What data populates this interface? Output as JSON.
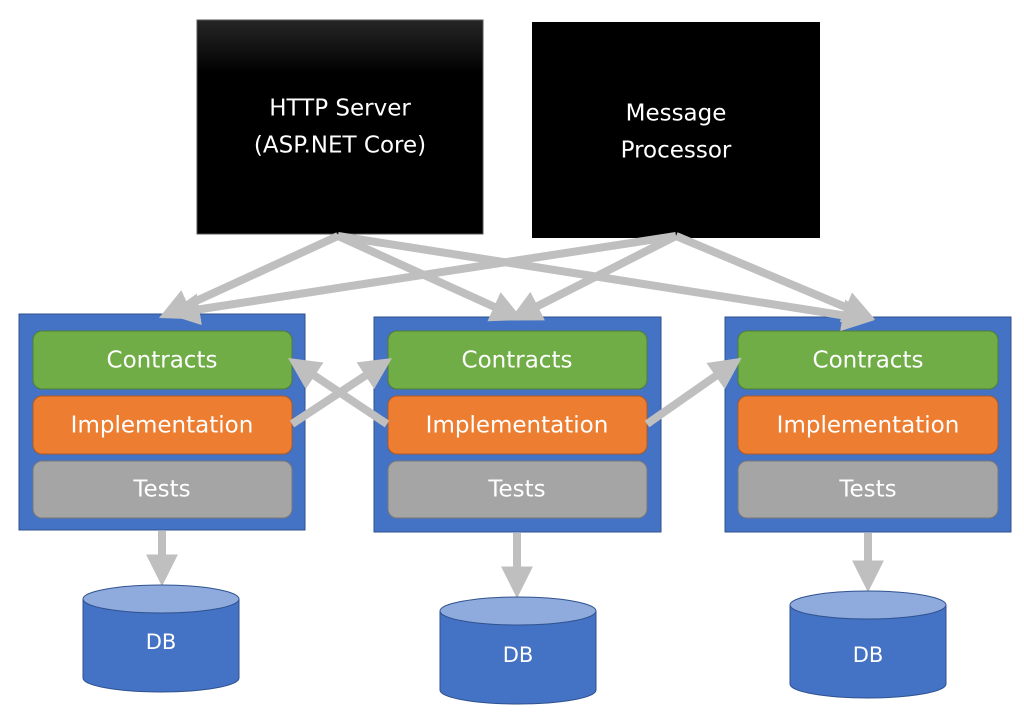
{
  "servers": [
    {
      "line1": "HTTP Server",
      "line2": "(ASP.NET Core)"
    },
    {
      "line1": "Message",
      "line2": "Processor"
    }
  ],
  "modules": [
    {
      "contracts": "Contracts",
      "implementation": "Implementation",
      "tests": "Tests",
      "db": "DB"
    },
    {
      "contracts": "Contracts",
      "implementation": "Implementation",
      "tests": "Tests",
      "db": "DB"
    },
    {
      "contracts": "Contracts",
      "implementation": "Implementation",
      "tests": "Tests",
      "db": "DB"
    }
  ],
  "colors": {
    "server": "#000000",
    "module": "#4472c4",
    "contracts": "#70ad47",
    "implementation": "#ed7d31",
    "tests": "#a5a5a5",
    "db_body": "#4472c4",
    "db_top": "#8faadc",
    "arrow": "#bfbfbf"
  }
}
